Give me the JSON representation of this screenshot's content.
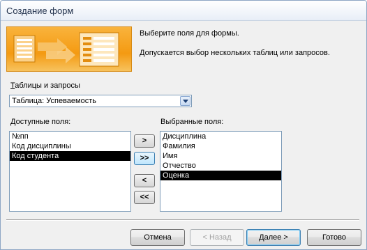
{
  "window": {
    "title": "Создание форм"
  },
  "intro": {
    "line1": "Выберите поля для формы.",
    "line2": "Допускается выбор нескольких таблиц или запросов."
  },
  "source": {
    "label": "Таблицы и запросы",
    "selected": "Таблица: Успеваемость"
  },
  "available": {
    "label": "Доступные поля:",
    "items": [
      "№пп",
      "Код дисциплины",
      "Код студента"
    ],
    "selected_index": 2
  },
  "chosen": {
    "label": "Выбранные поля:",
    "items": [
      "Дисциплина",
      "Фамилия",
      "Имя",
      "Отчество",
      "Оценка"
    ],
    "selected_index": 4
  },
  "move_buttons": {
    "add_one": ">",
    "add_all": ">>",
    "remove_one": "<",
    "remove_all": "<<"
  },
  "footer": {
    "cancel": "Отмена",
    "back": "< Назад",
    "next": "Далее >",
    "finish": "Готово"
  },
  "colors": {
    "banner": "#f49a12",
    "selection": "#000000",
    "default_button_border": "#3c7fb1"
  }
}
